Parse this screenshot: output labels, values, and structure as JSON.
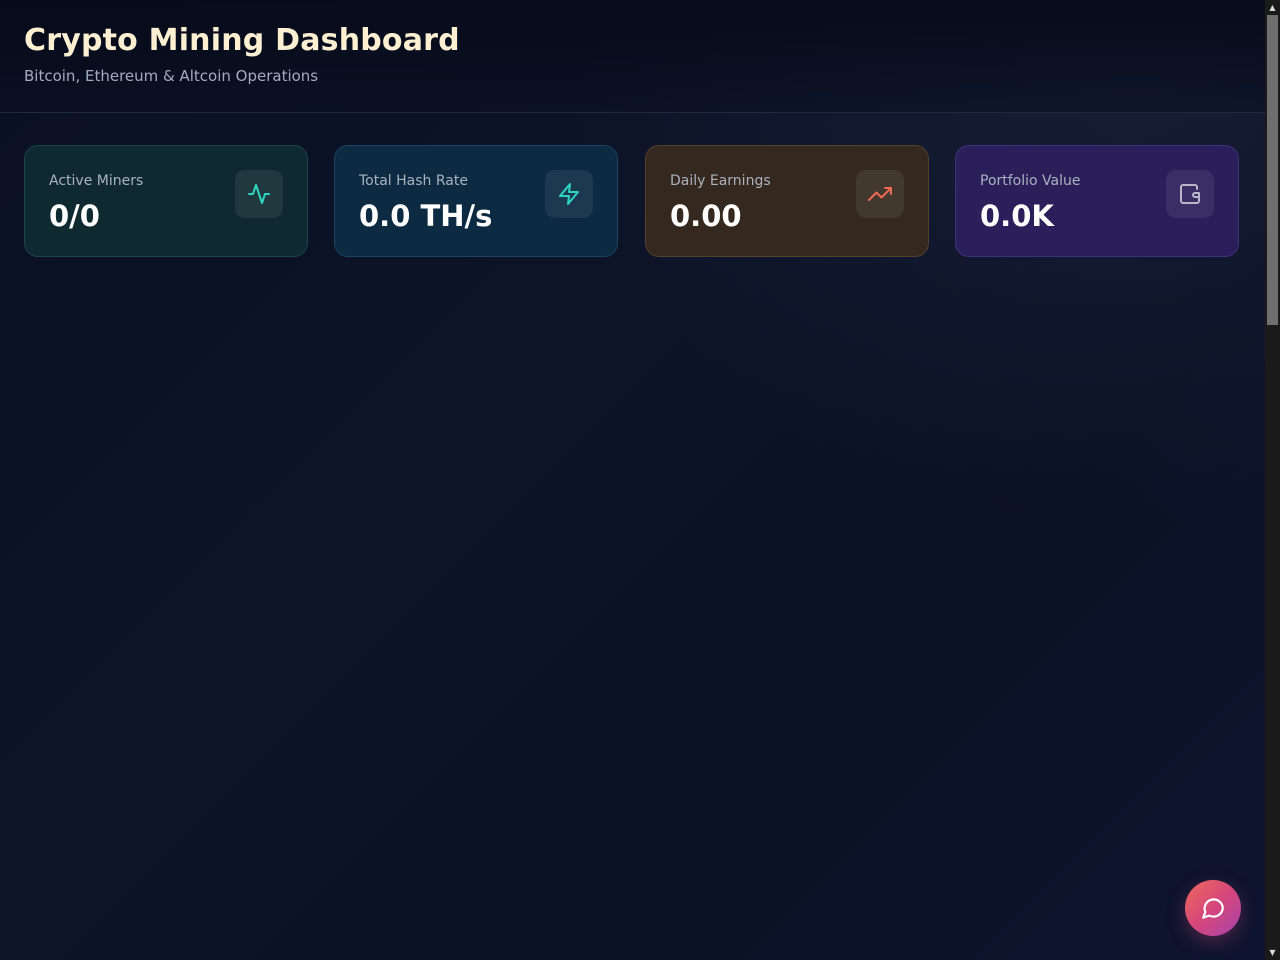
{
  "header": {
    "title": "Crypto Mining Dashboard",
    "subtitle": "Bitcoin, Ethereum & Altcoin Operations"
  },
  "stats": [
    {
      "label": "Active Miners",
      "value": "0/0",
      "icon": "activity-icon",
      "accent": "#2dd4bf"
    },
    {
      "label": "Total Hash Rate",
      "value": "0.0 TH/s",
      "icon": "lightning-icon",
      "accent": "#2dd4bf"
    },
    {
      "label": "Daily Earnings",
      "value": "0.00",
      "icon": "trending-up-icon",
      "accent": "#f26b55"
    },
    {
      "label": "Portfolio Value",
      "value": "0.0K",
      "icon": "wallet-icon",
      "accent": "#b8b6c8"
    }
  ],
  "chat": {
    "icon": "chat-bubble-icon"
  },
  "colors": {
    "title": "#fdf0d2",
    "background": "#0b1124",
    "fab_gradient_start": "#ef6a5a",
    "fab_gradient_end": "#a743b0"
  }
}
